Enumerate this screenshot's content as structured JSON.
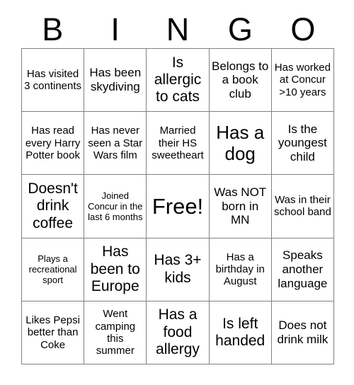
{
  "card": {
    "title": "BINGO",
    "header_letters": [
      "B",
      "I",
      "N",
      "G",
      "O"
    ],
    "columns": 5,
    "rows": 5,
    "free_space_index": 12,
    "colors": {
      "text": "#000000",
      "grid_line": "#808080",
      "background": "#ffffff"
    },
    "cells": [
      {
        "text": "Has visited 3 continents",
        "size": "s"
      },
      {
        "text": "Has been skydiving",
        "size": "m"
      },
      {
        "text": "Is allergic to cats",
        "size": "l"
      },
      {
        "text": "Belongs to a book club",
        "size": "m"
      },
      {
        "text": "Has worked at Concur >10 years",
        "size": "s"
      },
      {
        "text": "Has read every Harry Potter book",
        "size": "s"
      },
      {
        "text": "Has never seen a Star Wars film",
        "size": "s"
      },
      {
        "text": "Married their HS sweetheart",
        "size": "s"
      },
      {
        "text": "Has a dog",
        "size": "xl"
      },
      {
        "text": "Is the youngest child",
        "size": "m"
      },
      {
        "text": "Doesn't drink coffee",
        "size": "l"
      },
      {
        "text": "Joined Concur in the last 6 months",
        "size": "xs"
      },
      {
        "text": "Free!",
        "size": "xxl"
      },
      {
        "text": "Was NOT born in MN",
        "size": "m"
      },
      {
        "text": "Was in their school band",
        "size": "s"
      },
      {
        "text": "Plays a recreational sport",
        "size": "xs"
      },
      {
        "text": "Has been to Europe",
        "size": "l"
      },
      {
        "text": "Has 3+ kids",
        "size": "l"
      },
      {
        "text": "Has a birthday in August",
        "size": "s"
      },
      {
        "text": "Speaks another language",
        "size": "m"
      },
      {
        "text": "Likes Pepsi better than Coke",
        "size": "s"
      },
      {
        "text": "Went camping this summer",
        "size": "s"
      },
      {
        "text": "Has a food allergy",
        "size": "l"
      },
      {
        "text": "Is left handed",
        "size": "l"
      },
      {
        "text": "Does not drink milk",
        "size": "m"
      }
    ]
  }
}
